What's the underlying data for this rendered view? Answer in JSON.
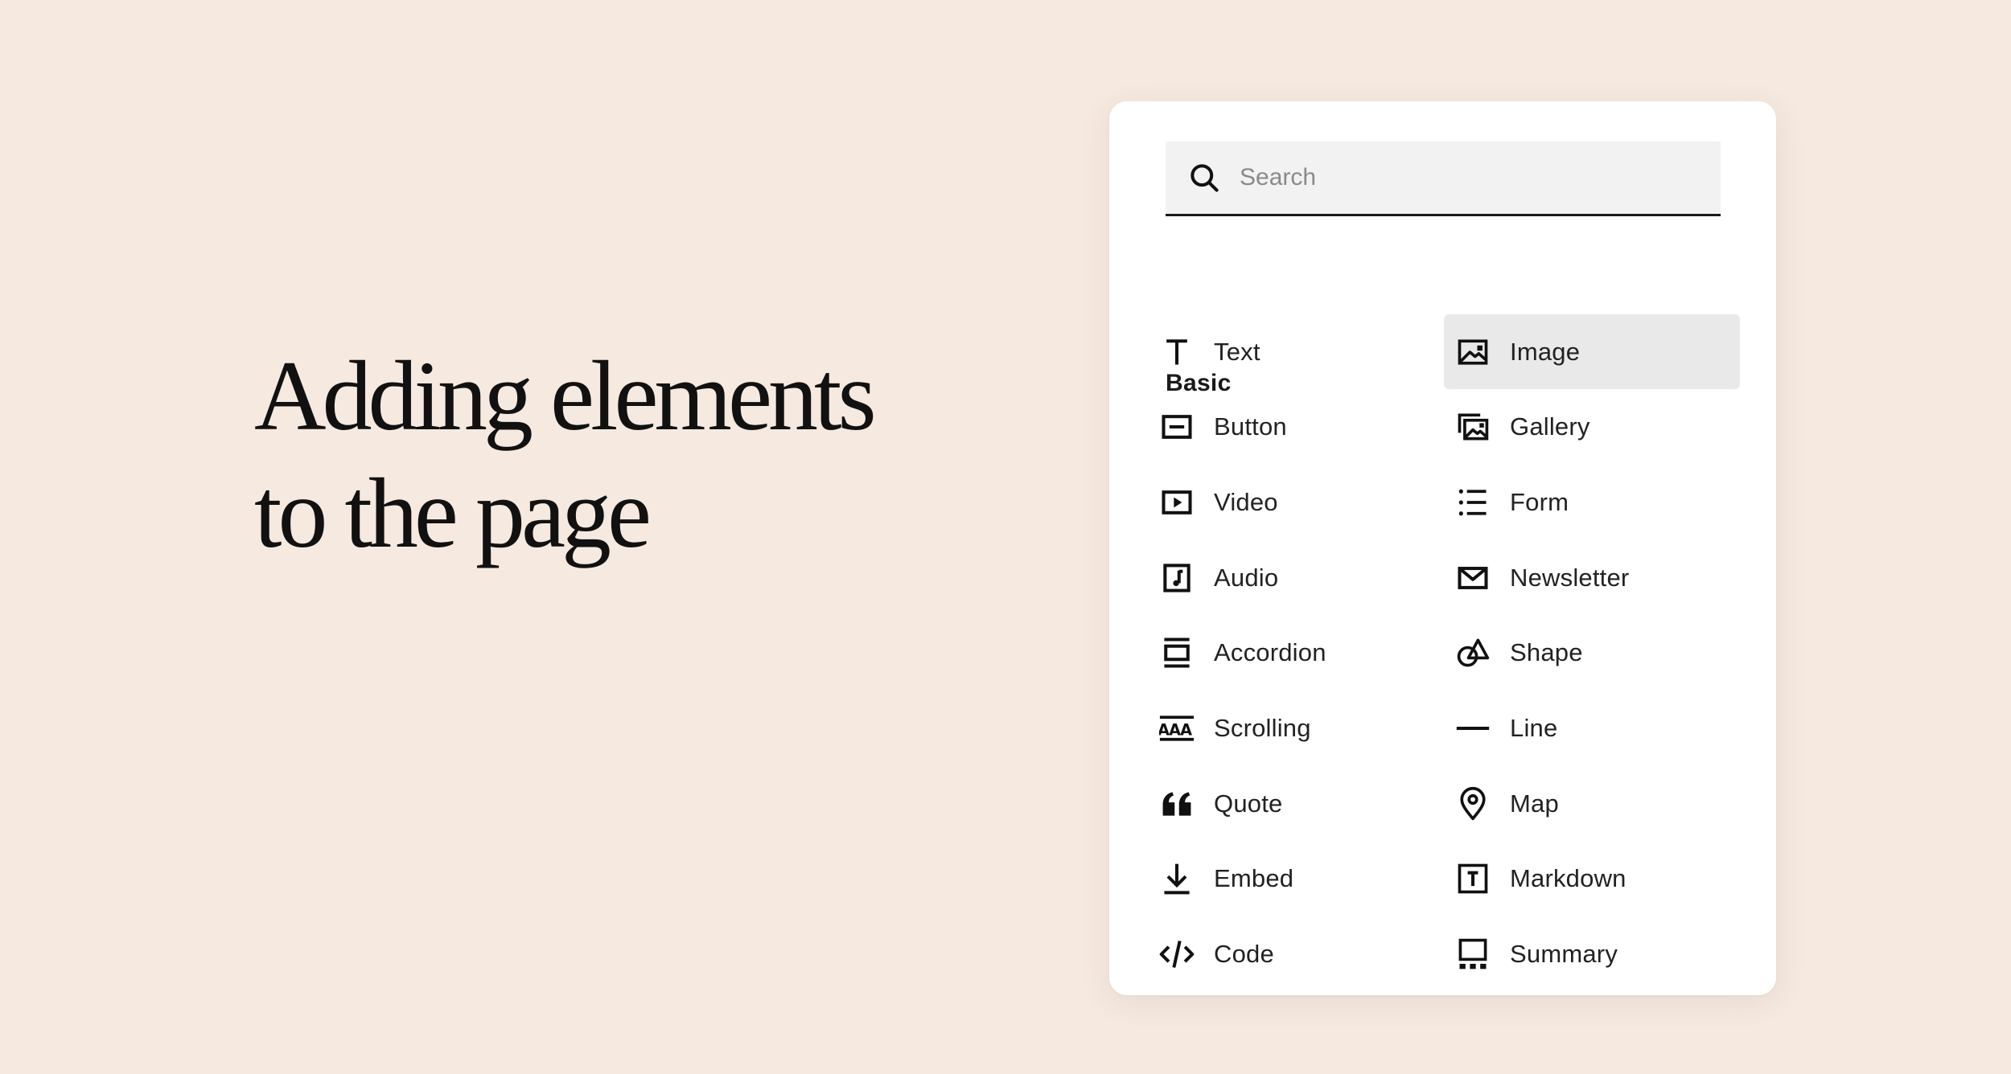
{
  "hero": {
    "line1": "Adding elements",
    "line2": "to the page"
  },
  "search": {
    "placeholder": "Search",
    "value": ""
  },
  "section": {
    "title": "Basic"
  },
  "items": {
    "text": "Text",
    "image": "Image",
    "button": "Button",
    "gallery": "Gallery",
    "video": "Video",
    "form": "Form",
    "audio": "Audio",
    "newsletter": "Newsletter",
    "accordion": "Accordion",
    "shape": "Shape",
    "scrolling": "Scrolling",
    "line": "Line",
    "quote": "Quote",
    "map": "Map",
    "embed": "Embed",
    "markdown": "Markdown",
    "code": "Code",
    "summary": "Summary"
  },
  "selected_item": "Image",
  "icons": {
    "text": "text-icon",
    "image": "image-icon",
    "button": "button-icon",
    "gallery": "gallery-icon",
    "video": "video-icon",
    "form": "list-icon",
    "audio": "audio-icon",
    "newsletter": "envelope-icon",
    "accordion": "accordion-icon",
    "shape": "shape-icon",
    "scrolling": "scrolling-text-icon",
    "line": "line-icon",
    "quote": "quote-icon",
    "map": "map-pin-icon",
    "embed": "download-icon",
    "markdown": "markdown-icon",
    "code": "code-icon",
    "summary": "summary-icon",
    "search": "search-icon"
  },
  "colors": {
    "background": "#f5e9e0",
    "panel": "#ffffff",
    "search_bg": "#f2f2f2",
    "selected_bg": "#e9e9e9",
    "text": "#111111"
  }
}
